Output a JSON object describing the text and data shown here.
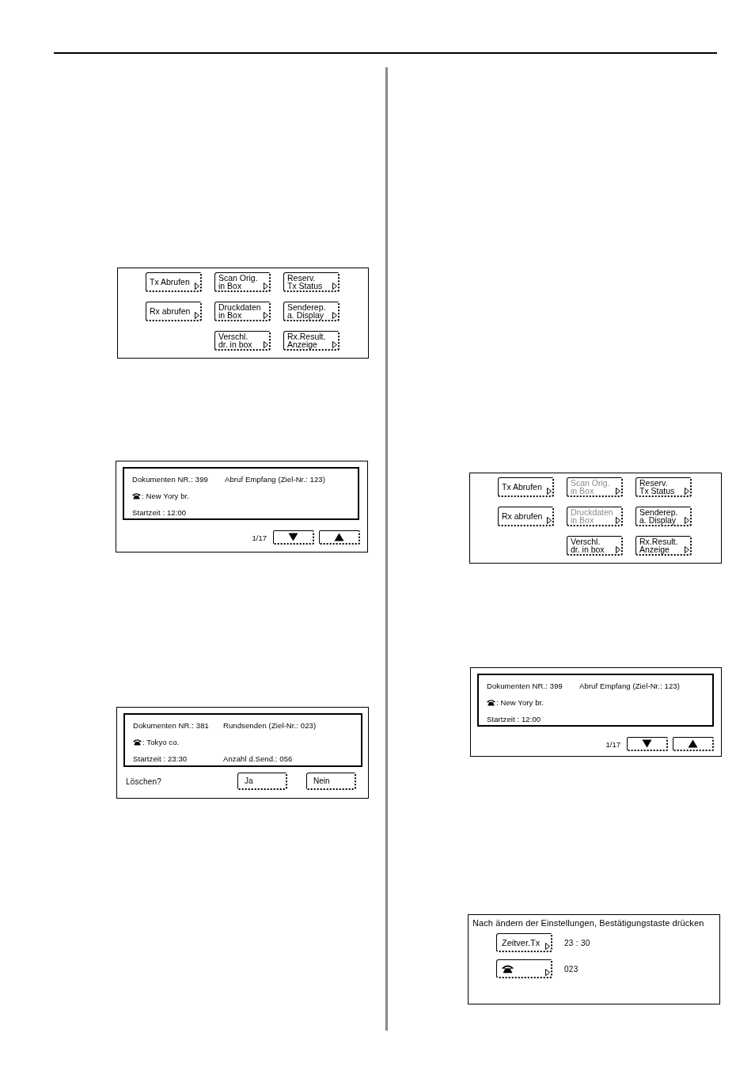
{
  "left_column": {
    "panels": [
      {
        "kind": "menu",
        "rows": [
          {
            "buttons": [
              {
                "label": "Tx Abrufen",
                "disabled": false
              },
              {
                "label": "Scan Orig.\nin Box",
                "disabled": false
              },
              {
                "label": "Reserv.\nTx Status",
                "disabled": false
              }
            ]
          },
          {
            "buttons": [
              {
                "label": "Rx abrufen",
                "disabled": false
              },
              {
                "label": "Druckdaten\nin Box",
                "disabled": false
              },
              {
                "label": "Senderep.\na. Display",
                "disabled": false
              }
            ]
          },
          {
            "buttons": [
              {
                "label": "Verschl.\ndr. in box",
                "disabled": false
              },
              {
                "label": "Rx.Result.\nAnzeige",
                "disabled": false
              }
            ]
          }
        ]
      },
      {
        "kind": "job_list",
        "doc_number": "Dokumenten NR.: 399",
        "job_type": "Abruf Empfang (Ziel-Nr.: 123)",
        "destination": ": New Yory br.",
        "start_time": "Startzeit : 12:00",
        "page": "1/17"
      },
      {
        "kind": "delete_confirm",
        "doc_number": "Dokumenten NR.: 381",
        "job_type": "Rundsenden (Ziel-Nr.: 023)",
        "destination": ": Tokyo co.",
        "start_time": "Startzeit : 23:30",
        "send_count": "Anzahl d.Send.: 056",
        "prompt": "Löschen?",
        "buttons": [
          "Ja",
          "Nein"
        ]
      }
    ]
  },
  "right_column": {
    "panels": [
      {
        "kind": "menu",
        "rows": [
          {
            "buttons": [
              {
                "label": "Tx Abrufen",
                "disabled": false
              },
              {
                "label": "Scan Orig.\nin Box",
                "disabled": true
              },
              {
                "label": "Reserv.\nTx Status",
                "disabled": false
              }
            ]
          },
          {
            "buttons": [
              {
                "label": "Rx abrufen",
                "disabled": false
              },
              {
                "label": "Druckdaten\nin Box",
                "disabled": true
              },
              {
                "label": "Senderep.\na. Display",
                "disabled": false
              }
            ]
          },
          {
            "buttons": [
              {
                "label": "Verschl.\ndr. in box",
                "disabled": false
              },
              {
                "label": "Rx.Result.\nAnzeige",
                "disabled": false
              }
            ]
          }
        ]
      },
      {
        "kind": "job_list",
        "doc_number": "Dokumenten NR.: 399",
        "job_type": "Abruf Empfang (Ziel-Nr.: 123)",
        "destination": ": New Yory br.",
        "start_time": "Startzeit : 12:00",
        "page": "1/17"
      },
      {
        "kind": "settings",
        "title": "Nach ändern der Einstellungen, Bestätigungstaste drücken",
        "rows": [
          {
            "kind": "label",
            "label": "Zeitver.Tx",
            "value": "23 : 30"
          },
          {
            "kind": "phone",
            "value": "023"
          }
        ]
      }
    ]
  }
}
